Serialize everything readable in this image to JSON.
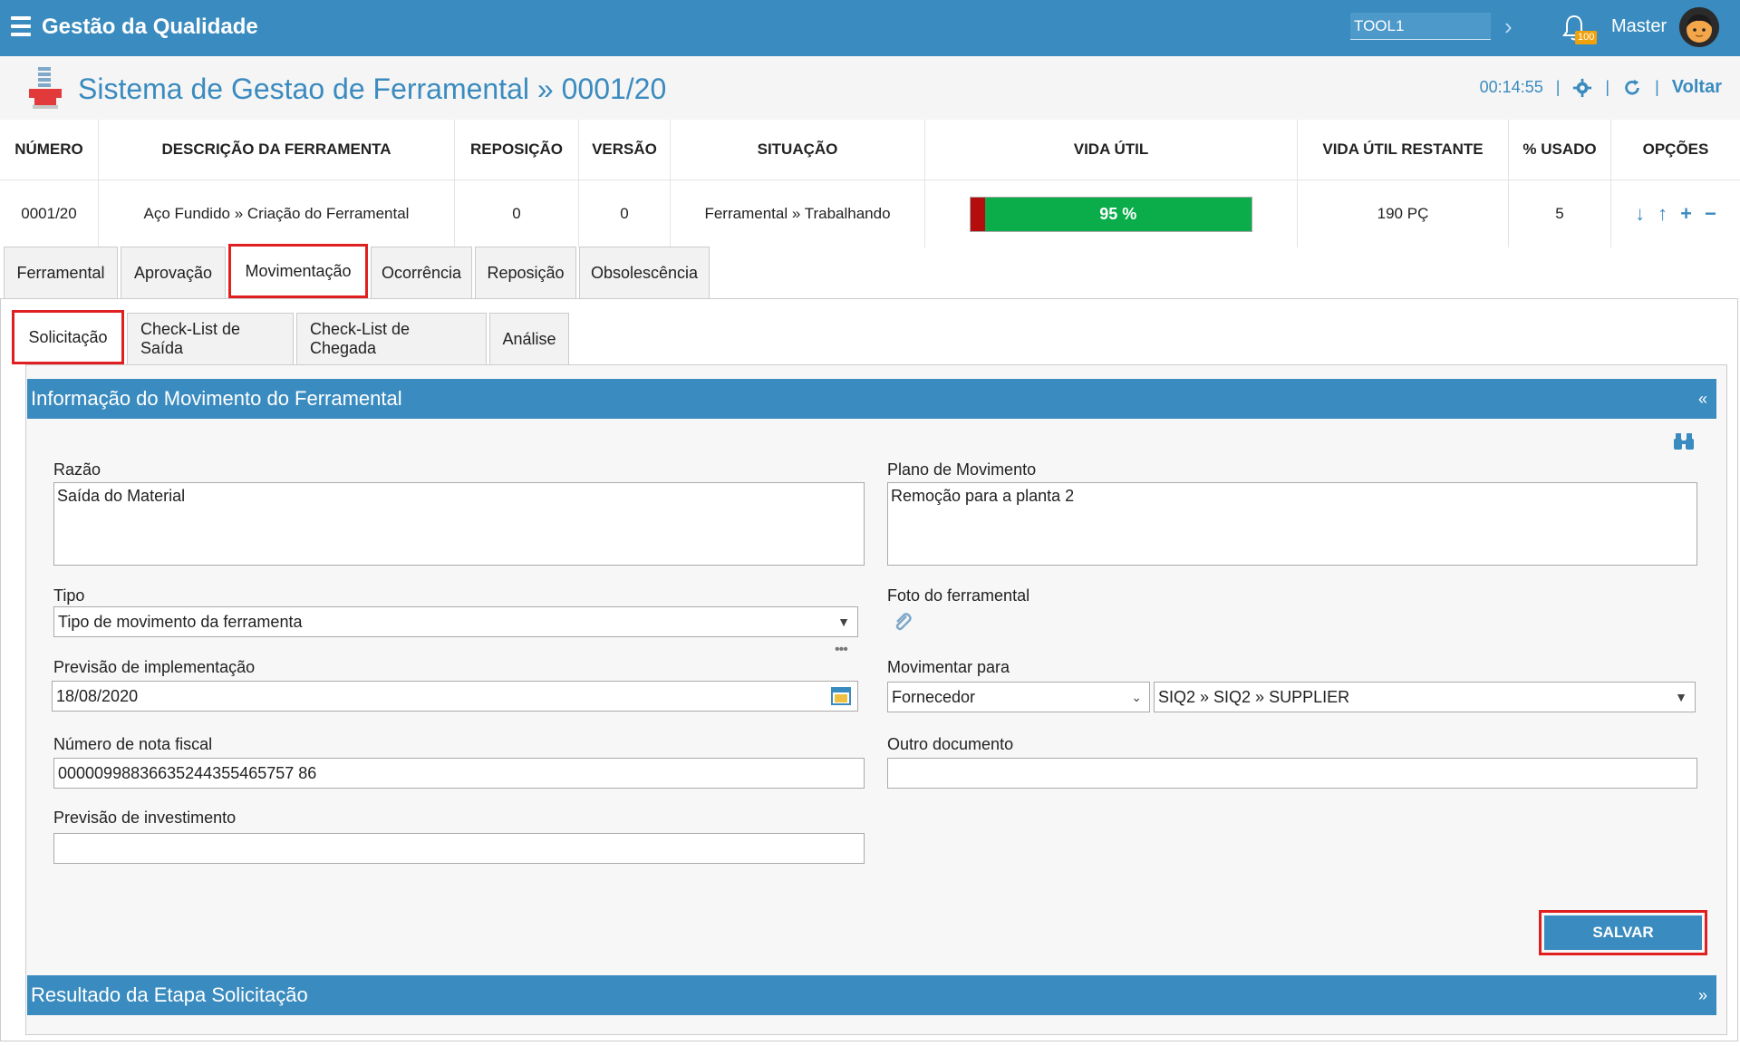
{
  "topbar": {
    "app_title": "Gestão da Qualidade",
    "tool_value": "TOOL1",
    "notif_count": "100",
    "user_name": "Master"
  },
  "header": {
    "title": "Sistema de Gestao de Ferramental » 0001/20",
    "time": "00:14:55",
    "back_label": "Voltar"
  },
  "table": {
    "columns": [
      "NÚMERO",
      "DESCRIÇÃO DA FERRAMENTA",
      "REPOSIÇÃO",
      "VERSÃO",
      "SITUAÇÃO",
      "VIDA ÚTIL",
      "VIDA ÚTIL RESTANTE",
      "% USADO",
      "OPÇÕES"
    ],
    "row": {
      "numero": "0001/20",
      "descricao": "Aço Fundido » Criação do Ferramental",
      "reposicao": "0",
      "versao": "0",
      "situacao": "Ferramental » Trabalhando",
      "vida_util": "95 %",
      "vida_util_fraction": 0.95,
      "vida_restante": "190 PÇ",
      "usado": "5"
    }
  },
  "tabs": [
    "Ferramental",
    "Aprovação",
    "Movimentação",
    "Ocorrência",
    "Reposição",
    "Obsolescência"
  ],
  "subtabs": [
    "Solicitação",
    "Check-List de Saída",
    "Check-List de Chegada",
    "Análise"
  ],
  "section1": {
    "title": "Informação do Movimento do Ferramental",
    "chevron": "«"
  },
  "form": {
    "razao_label": "Razão",
    "razao_value": "Saída do Material",
    "plano_label": "Plano de Movimento",
    "plano_value": "Remoção para a planta 2",
    "tipo_label": "Tipo",
    "tipo_value": "Tipo de movimento da ferramenta",
    "foto_label": "Foto do ferramental",
    "previsao_label": "Previsão de implementação",
    "previsao_value": "18/08/2020",
    "movimentar_label": "Movimentar para",
    "movimentar_type": "Fornecedor",
    "movimentar_dest": "SIQ2 » SIQ2 » SUPPLIER",
    "nota_label": "Número de nota fiscal",
    "nota_value": "00000998836635244355465757 86",
    "outro_label": "Outro documento",
    "outro_value": "",
    "invest_label": "Previsão de investimento",
    "invest_value": "",
    "save_label": "SALVAR"
  },
  "section2": {
    "title": "Resultado da Etapa Solicitação",
    "chevron": "»"
  },
  "colors": {
    "primary": "#3a8bbf",
    "highlight": "#e02020",
    "good": "#0bac4a",
    "bad": "#b50d0d"
  }
}
